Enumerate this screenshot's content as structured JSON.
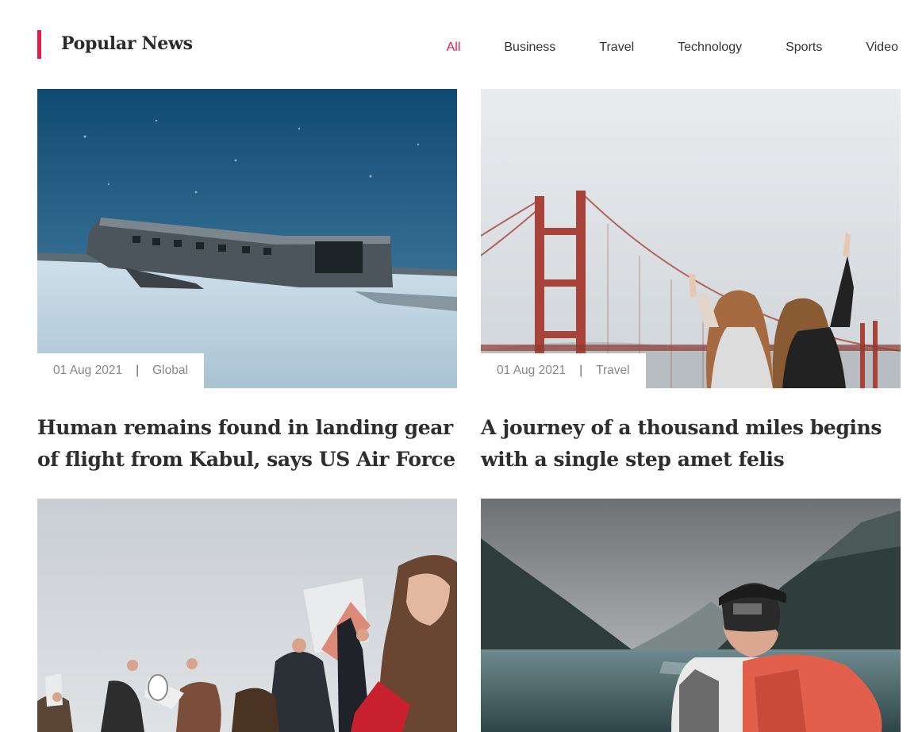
{
  "section": {
    "title": "Popular News",
    "accent_color": "#e8194a"
  },
  "filters": [
    {
      "label": "All",
      "active": true
    },
    {
      "label": "Business",
      "active": false
    },
    {
      "label": "Travel",
      "active": false
    },
    {
      "label": "Technology",
      "active": false
    },
    {
      "label": "Sports",
      "active": false
    },
    {
      "label": "Video",
      "active": false
    }
  ],
  "articles": [
    {
      "date": "01 Aug 2021",
      "category": "Global",
      "title": "Human remains found in landing gear of flight from Kabul, says US Air Force",
      "image": "plane-wreck-snow-image"
    },
    {
      "date": "01 Aug 2021",
      "category": "Travel",
      "title": "A journey of a thousand miles begins with a single step amet felis",
      "image": "golden-gate-bridge-friends-image"
    },
    {
      "image": "protest-crowd-megaphone-image"
    },
    {
      "image": "hiker-lake-mountains-image"
    }
  ]
}
